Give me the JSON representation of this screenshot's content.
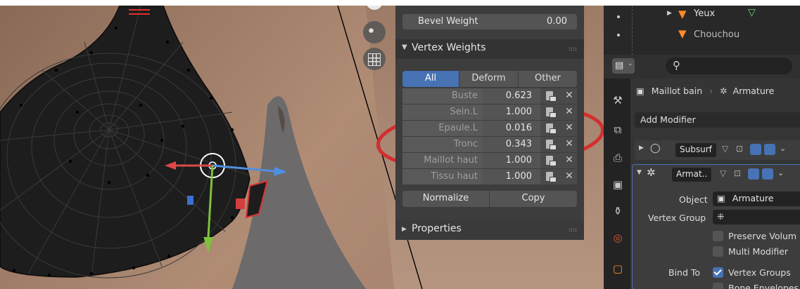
{
  "colors": {
    "panel_bg": "#3d3d3d",
    "accent": "#4772b3",
    "skin": "#a7856f",
    "mesh": "#1e1e1e",
    "annotation": "#d32f2f"
  },
  "viewport": {
    "gizmo_icons": [
      "camera-icon",
      "grid-icon"
    ]
  },
  "n_panel": {
    "bevel_weight": {
      "label": "Bevel Weight",
      "value": "0.00"
    },
    "vertex_weights_header": "Vertex Weights",
    "tabs": [
      "All",
      "Deform",
      "Other"
    ],
    "groups": [
      {
        "name": "Buste",
        "value": "0.623"
      },
      {
        "name": "Sein.L",
        "value": "1.000"
      },
      {
        "name": "Epaule.L",
        "value": "0.016"
      },
      {
        "name": "Tronc",
        "value": "0.343"
      },
      {
        "name": "Maillot haut",
        "value": "1.000"
      },
      {
        "name": "Tissu haut",
        "value": "1.000"
      }
    ],
    "normalize_label": "Normalize",
    "copy_label": "Copy",
    "properties_header": "Properties"
  },
  "outliner": {
    "items": [
      {
        "label": "Yeux"
      },
      {
        "label": "Chouchou"
      }
    ]
  },
  "properties": {
    "breadcrumb_object": "Maillot bain",
    "breadcrumb_separator": "›",
    "breadcrumb_armature": "Armature",
    "add_modifier": "Add Modifier",
    "subsurf_name": "Subsurf",
    "armature_name": "Armat..",
    "object_label": "Object",
    "object_value": "Armature",
    "vertex_group_label": "Vertex Group",
    "preserve_volume": "Preserve Volum",
    "multi_modifier": "Multi Modifier",
    "bind_to_label": "Bind To",
    "vertex_groups": "Vertex Groups",
    "bone_envelopes": "Bone Envelopes"
  }
}
